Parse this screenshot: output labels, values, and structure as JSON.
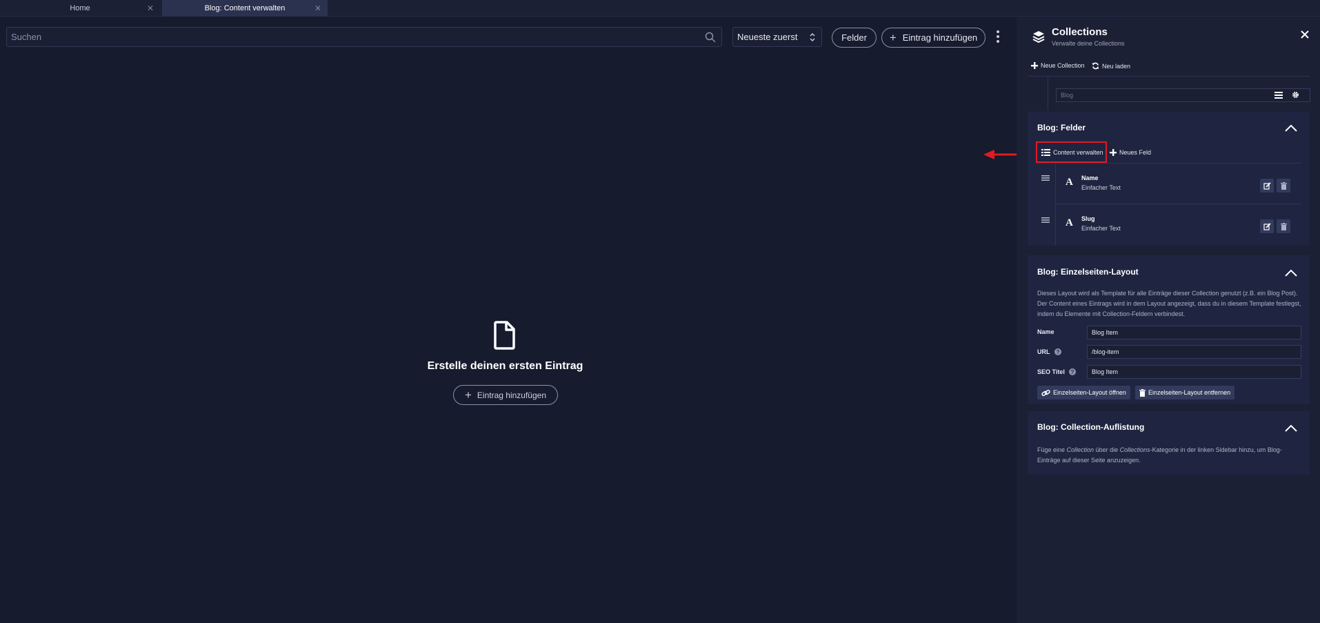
{
  "tabs": [
    {
      "label": "Home",
      "active": false
    },
    {
      "label": "Blog: Content verwalten",
      "active": true
    }
  ],
  "toolbar": {
    "search_placeholder": "Suchen",
    "sort_value": "Neueste zuerst",
    "fields_label": "Felder",
    "add_entry_label": "Eintrag hinzufügen"
  },
  "empty_state": {
    "title": "Erstelle deinen ersten Eintrag",
    "add_label": "Eintrag hinzufügen"
  },
  "panel": {
    "title": "Collections",
    "subtitle": "Verwalte deine Collections",
    "new_collection": "Neue Collection",
    "reload": "Neu laden",
    "collection_placeholder": "Blog",
    "fields_section": {
      "title": "Blog: Felder",
      "manage_content": "Content verwalten",
      "new_field": "Neues Feld",
      "fields": [
        {
          "name": "Name",
          "type": "Einfacher Text"
        },
        {
          "name": "Slug",
          "type": "Einfacher Text"
        }
      ]
    },
    "layout_section": {
      "title": "Blog: Einzelseiten-Layout",
      "description": "Dieses Layout wird als Template für alle Einträge dieser Collection genutzt (z.B. ein Blog Post). Der Content eines Eintrags wird in dem Layout angezeigt, dass du in diesem Template festlegst, indem du Elemente mit Collection-Feldern verbindest.",
      "name_label": "Name",
      "name_value": "Blog Item",
      "url_label": "URL",
      "url_value": "/blog-item",
      "seo_label": "SEO Titel",
      "seo_value": "Blog Item",
      "open_layout": "Einzelseiten-Layout öffnen",
      "remove_layout": "Einzelseiten-Layout entfernen"
    },
    "listing_section": {
      "title": "Blog: Collection-Auflistung",
      "desc_part1": "Füge eine ",
      "desc_em1": "Collection",
      "desc_part2": " über die ",
      "desc_em2": "Collections",
      "desc_part3": "-Kategorie in der linken Sidebar hinzu, um Blog-Einträge auf dieser Seite anzuzeigen."
    }
  },
  "colors": {
    "background": "#161b2e",
    "panel": "#1b2035",
    "section": "#1f2540",
    "highlight": "#e11b22"
  }
}
